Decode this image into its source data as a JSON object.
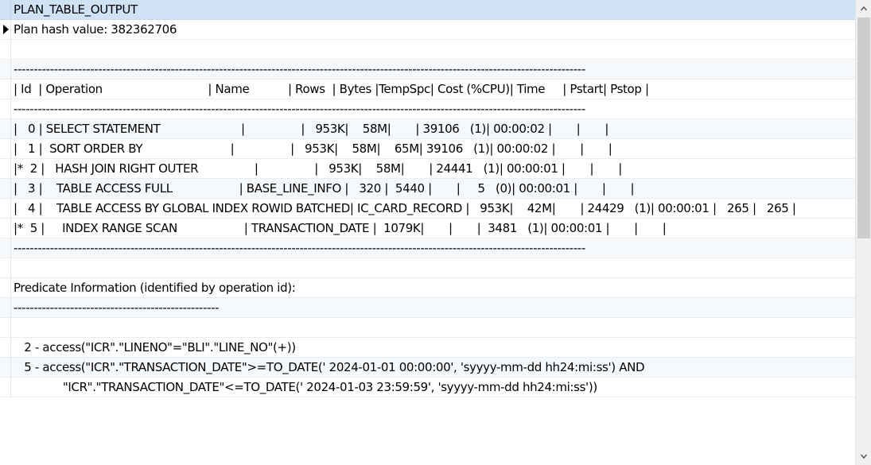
{
  "grid": {
    "column_header": "PLAN_TABLE_OUTPUT",
    "rows": [
      "Plan hash value: 382362706",
      "",
      "----------------------------------------------------------------------------------------------------------------------------------------------",
      "| Id  | Operation                              | Name           | Rows  | Bytes |TempSpc| Cost (%CPU)| Time     | Pstart| Pstop |",
      "----------------------------------------------------------------------------------------------------------------------------------------------",
      "|   0 | SELECT STATEMENT                       |                |   953K|    58M|       | 39106   (1)| 00:00:02 |       |       |",
      "|   1 |  SORT ORDER BY                         |                |   953K|    58M|    65M| 39106   (1)| 00:00:02 |       |       |",
      "|*  2 |   HASH JOIN RIGHT OUTER                |                |   953K|    58M|       | 24441   (1)| 00:00:01 |       |       |",
      "|   3 |    TABLE ACCESS FULL                   | BASE_LINE_INFO |   320 |  5440 |       |     5   (0)| 00:00:01 |       |       |",
      "|   4 |    TABLE ACCESS BY GLOBAL INDEX ROWID BATCHED| IC_CARD_RECORD |   953K|    42M|       | 24429   (1)| 00:00:01 |   265 |   265 |",
      "|*  5 |     INDEX RANGE SCAN                   | TRANSACTION_DATE |  1079K|       |       |  3481   (1)| 00:00:01 |       |       |",
      "----------------------------------------------------------------------------------------------------------------------------------------------",
      "",
      "Predicate Information (identified by operation id):",
      "---------------------------------------------------",
      "",
      "   2 - access(\"ICR\".\"LINENO\"=\"BLI\".\"LINE_NO\"(+))",
      "   5 - access(\"ICR\".\"TRANSACTION_DATE\">=TO_DATE(' 2024-01-01 00:00:00', 'syyyy-mm-dd hh24:mi:ss') AND",
      "              \"ICR\".\"TRANSACTION_DATE\"<=TO_DATE(' 2024-01-03 23:59:59', 'syyyy-mm-dd hh24:mi:ss'))"
    ]
  },
  "scrollbar": {
    "up_icon": "chevron-up-icon",
    "down_icon": "chevron-down-icon"
  },
  "colors": {
    "header_bg": "#cfe2f6",
    "alt_row_bg": "#f6f9fc",
    "gridline": "#ececec",
    "scroll_track": "#f0f0f0",
    "scroll_thumb": "#cdcdcd"
  }
}
